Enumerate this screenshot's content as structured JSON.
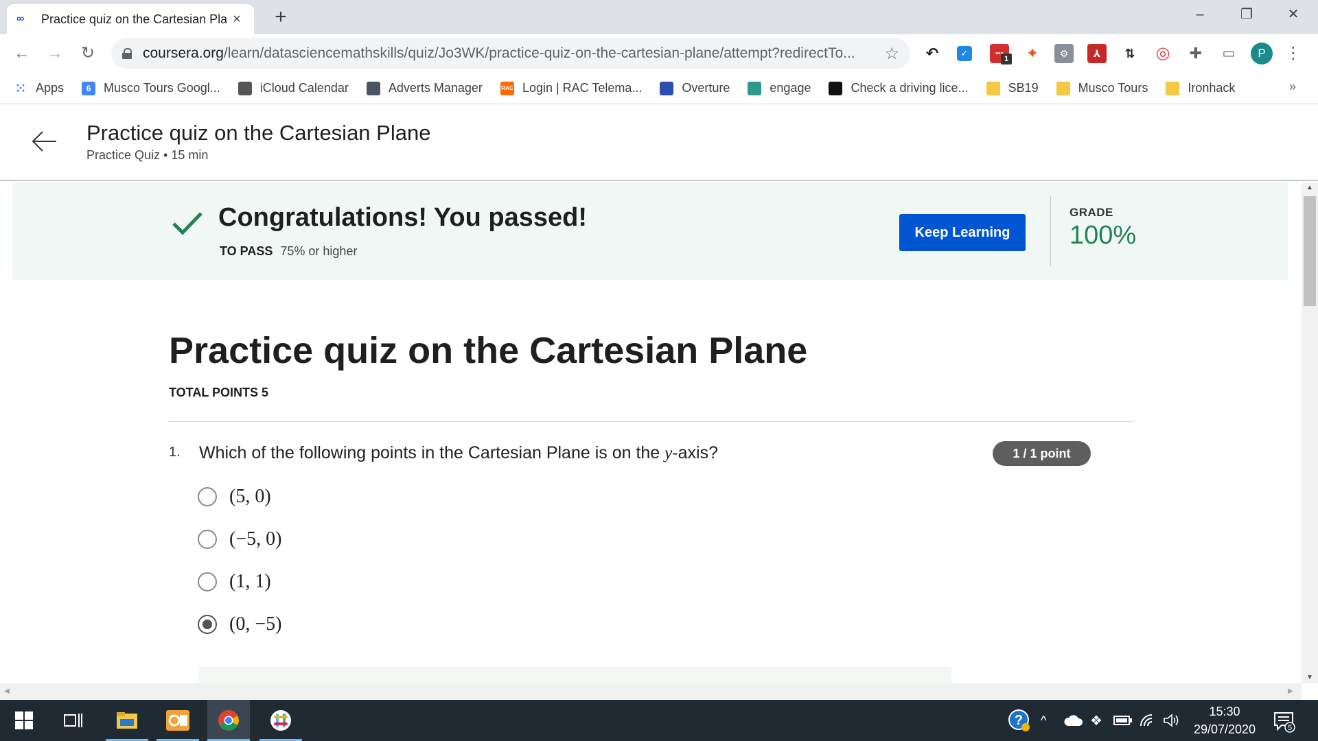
{
  "browser": {
    "tab_title": "Practice quiz on the Cartesian Pla",
    "tab_close": "×",
    "new_tab": "+",
    "url_host": "coursera.org",
    "url_path": "/learn/datasciencemathskills/quiz/Jo3WK/practice-quiz-on-the-cartesian-plane/attempt?redirectTo...",
    "profile_initial": "P",
    "extension_badge": "1",
    "bookmarks": [
      {
        "label": "Apps",
        "icon": "apps-grid-icon",
        "color": "#4285f4"
      },
      {
        "label": "Musco Tours Googl...",
        "icon": "google-calendar-icon",
        "color": "#4285f4",
        "glyph": "6"
      },
      {
        "label": "iCloud Calendar",
        "icon": "apple-icon",
        "color": "#555555",
        "glyph": ""
      },
      {
        "label": "Adverts Manager",
        "icon": "adverts-icon",
        "color": "#4a5561",
        "glyph": ""
      },
      {
        "label": "Login | RAC Telema...",
        "icon": "rac-icon",
        "color": "#ff6a00",
        "glyph": "RAC"
      },
      {
        "label": "Overture",
        "icon": "overture-icon",
        "color": "#2b4fb0",
        "glyph": ""
      },
      {
        "label": "engage",
        "icon": "engage-icon",
        "color": "#2b9a8a",
        "glyph": ""
      },
      {
        "label": "Check a driving lice...",
        "icon": "gov-uk-icon",
        "color": "#111111",
        "glyph": ""
      },
      {
        "label": "SB19",
        "icon": "folder-icon",
        "color": "#f6c944",
        "glyph": ""
      },
      {
        "label": "Musco Tours",
        "icon": "folder-icon",
        "color": "#f6c944",
        "glyph": ""
      },
      {
        "label": "Ironhack",
        "icon": "folder-icon",
        "color": "#f6c944",
        "glyph": ""
      }
    ],
    "bookmarks_more": "»"
  },
  "header": {
    "title": "Practice quiz on the Cartesian Plane",
    "subtitle": "Practice Quiz • 15 min"
  },
  "banner": {
    "title": "Congratulations! You passed!",
    "to_pass_label": "TO PASS",
    "to_pass_value": "75% or higher",
    "button_label": "Keep Learning",
    "grade_label": "GRADE",
    "grade_value": "100%",
    "accent_color": "#1f8354",
    "button_color": "#0056d2"
  },
  "quiz": {
    "title": "Practice quiz on the Cartesian Plane",
    "total_points": "TOTAL POINTS 5",
    "question": {
      "number": "1.",
      "text_before": "Which of the following points in the Cartesian Plane is on the ",
      "text_math": "y",
      "text_after": "-axis?",
      "points": "1 / 1 point",
      "options": [
        {
          "label": "(5, 0)",
          "selected": false
        },
        {
          "label": "(−5, 0)",
          "selected": false
        },
        {
          "label": "(1, 1)",
          "selected": false
        },
        {
          "label": "(0, −5)",
          "selected": true
        }
      ]
    }
  },
  "taskbar": {
    "time": "15:30",
    "date": "29/07/2020",
    "notification_count": "5"
  }
}
